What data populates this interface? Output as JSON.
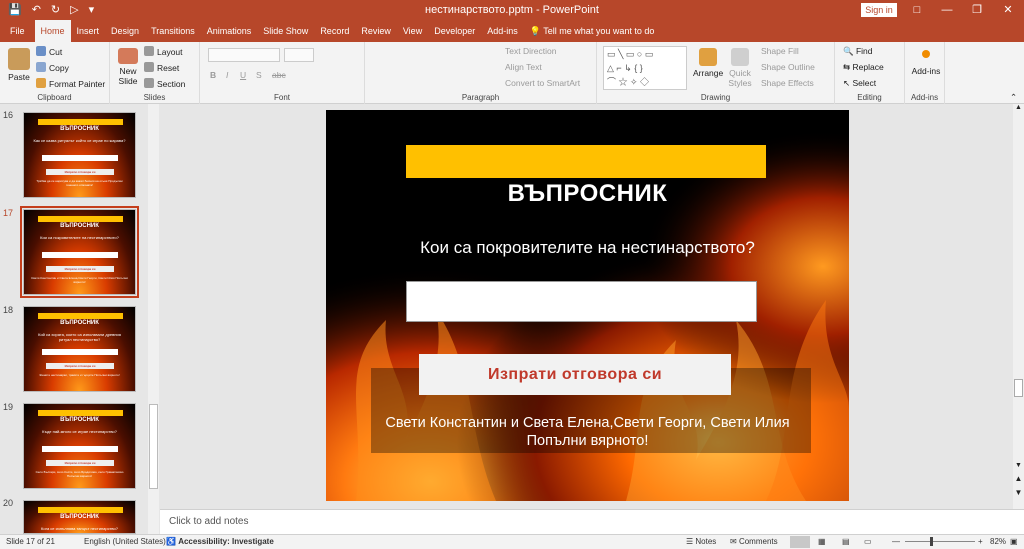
{
  "window": {
    "title": "нестинарството.pptm  -  PowerPoint",
    "signin": "Sign in"
  },
  "tabs": [
    "File",
    "Home",
    "Insert",
    "Design",
    "Transitions",
    "Animations",
    "Slide Show",
    "Record",
    "Review",
    "View",
    "Developer",
    "Add-ins"
  ],
  "tell_me": "Tell me what you want to do",
  "ribbon": {
    "clipboard": {
      "paste": "Paste",
      "cut": "Cut",
      "copy": "Copy",
      "format_painter": "Format Painter",
      "label": "Clipboard"
    },
    "slides": {
      "new_slide": "New Slide",
      "layout": "Layout",
      "reset": "Reset",
      "section": "Section",
      "label": "Slides"
    },
    "font": {
      "label": "Font"
    },
    "paragraph": {
      "text_direction": "Text Direction",
      "align_text": "Align Text",
      "convert_smartart": "Convert to SmartArt",
      "label": "Paragraph"
    },
    "drawing": {
      "arrange": "Arrange",
      "quick_styles": "Quick Styles",
      "shape_fill": "Shape Fill",
      "shape_outline": "Shape Outline",
      "shape_effects": "Shape Effects",
      "label": "Drawing"
    },
    "editing": {
      "find": "Find",
      "replace": "Replace",
      "select": "Select",
      "label": "Editing"
    },
    "addins": {
      "addins": "Add-ins",
      "label": "Add-ins"
    }
  },
  "thumbnails": [
    {
      "number": "16",
      "title": "ВЪПРОСНИК",
      "question": "Как се казва ритуалът който се играе по жарава?",
      "button": "Изпрати отговора си",
      "answer": "Трябва да се нарисува и да кажат бесния на огъня Продължи гоненето отмяната!"
    },
    {
      "number": "17",
      "title": "ВЪПРОСНИК",
      "question": "Кои са покровителите на нестинарството?",
      "button": "Изпрати отговора си",
      "answer": "Свети Константин и Света Елена,Свети Георги, Свети Илия Попълни вярното!"
    },
    {
      "number": "18",
      "title": "ВЪПРОСНИК",
      "question": "Кой са хората, които са използвали древния ритуал нестинарство?",
      "button": "Изпрати отговора си",
      "answer": "Жените нестинарки, траките и гърците Попълни вярното!"
    },
    {
      "number": "19",
      "title": "ВЪПРОСНИК",
      "question": "Къде най-много се играе нестинарство?",
      "button": "Изпрати отговора си",
      "answer": "Село Българи, село Кости, село Бродилово, село Граматиково Попълни вярното!"
    },
    {
      "number": "20",
      "title": "ВЪПРОСНИК",
      "question": "Кога се изпълнява танцът нестинарство?",
      "button": "",
      "answer": ""
    }
  ],
  "slide": {
    "title": "ВЪПРОСНИК",
    "question": "Кои са покровителите на нестинарството?",
    "answer_value": "",
    "submit_label": "Изпрати отговора си",
    "answer_line1": "Свети Константин и Света Елена,Свети Георги, Свети Илия",
    "answer_line2": "Попълни вярното!"
  },
  "notes_placeholder": "Click to add notes",
  "status": {
    "slide_of": "Slide 17 of 21",
    "language": "English (United States)",
    "accessibility": "Accessibility: Investigate",
    "notes": "Notes",
    "comments": "Comments",
    "zoom": "82%"
  },
  "colors": {
    "accent": "#b7472a",
    "yellow_bar": "#ffc000",
    "submit_text": "#c0392b"
  }
}
